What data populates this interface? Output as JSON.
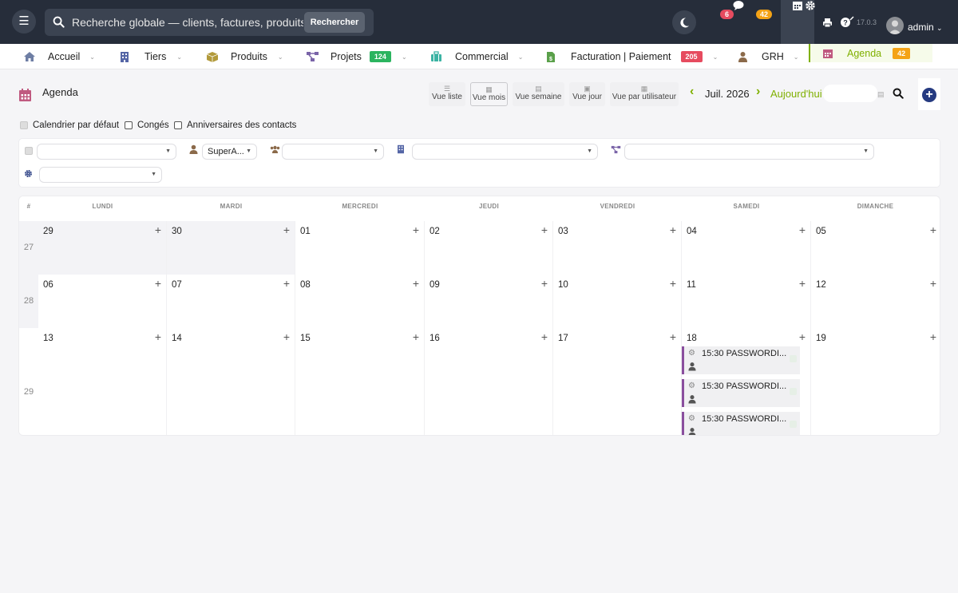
{
  "topbar": {
    "menu_icon": "hamburger-icon",
    "search_placeholder": "Recherche globale — clients, factures, produits...",
    "search_button": "Rechercher",
    "messages_count": "6",
    "agenda_count": "42",
    "version": "17.0.3",
    "user_name": "admin"
  },
  "nav": {
    "items": [
      {
        "label": "Accueil",
        "icon": "home-icon"
      },
      {
        "label": "Tiers",
        "icon": "building-icon"
      },
      {
        "label": "Produits",
        "icon": "box-icon"
      },
      {
        "label": "Projets",
        "icon": "project-icon",
        "badge": "124"
      },
      {
        "label": "Commercial",
        "icon": "briefcase-icon"
      },
      {
        "label": "Facturation | Paiement",
        "icon": "invoice-icon",
        "badge": "205"
      },
      {
        "label": "GRH",
        "icon": "user-tie-icon"
      },
      {
        "label": "Agenda",
        "icon": "calendar-icon",
        "badge": "42"
      }
    ]
  },
  "page": {
    "title": "Agenda",
    "views": [
      {
        "label": "Vue liste"
      },
      {
        "label": "Vue mois"
      },
      {
        "label": "Vue semaine"
      },
      {
        "label": "Vue jour"
      },
      {
        "label": "Vue par utilisateur"
      }
    ],
    "month_label": "Juil. 2026",
    "today_label": "Aujourd'hui"
  },
  "checks": {
    "default_calendar": "Calendrier par défaut",
    "holidays": "Congés",
    "birthdays": "Anniversaires des contacts"
  },
  "filters": {
    "user_value": "SuperA..."
  },
  "calendar": {
    "headers": [
      "#",
      "LUNDI",
      "MARDI",
      "MERCREDI",
      "JEUDI",
      "VENDREDI",
      "SAMEDI",
      "DIMANCHE"
    ],
    "weeks": [
      {
        "num": "27",
        "days": [
          "29",
          "30",
          "01",
          "02",
          "03",
          "04",
          "05"
        ]
      },
      {
        "num": "28",
        "days": [
          "06",
          "07",
          "08",
          "09",
          "10",
          "11",
          "12"
        ]
      },
      {
        "num": "29",
        "days": [
          "13",
          "14",
          "15",
          "16",
          "17",
          "18",
          "19"
        ]
      }
    ],
    "events": [
      {
        "label": "15:30 PASSWORDI..."
      },
      {
        "label": "15:30 PASSWORDI..."
      },
      {
        "label": "15:30 PASSWORDI..."
      }
    ],
    "add_symbol": "+"
  },
  "colors": {
    "topbar": "#262d3a",
    "accent_green": "#7fb000",
    "badge_red": "#e64b5f",
    "badge_orange": "#f4a316",
    "badge_green": "#2bb45f",
    "event_border": "#8a4e9e"
  }
}
